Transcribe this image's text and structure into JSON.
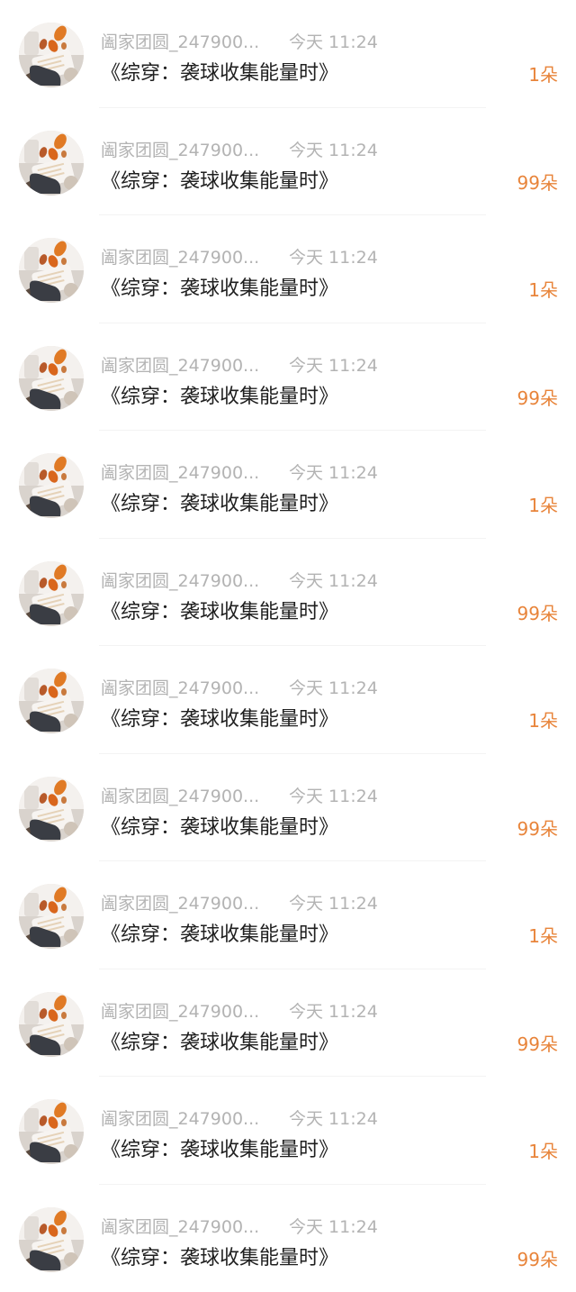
{
  "colors": {
    "meta_text": "#b3b3b3",
    "title_text": "#1f1f1f",
    "gift_accent": "#e8843a",
    "divider": "#f3f3f3"
  },
  "list": {
    "items": [
      {
        "avatar_icon": "user-avatar-autumn-leaves",
        "username": "阖家团圆_247900...",
        "time": "今天 11:24",
        "title": "《综穿：袭球收集能量时》",
        "gift": "1朵"
      },
      {
        "avatar_icon": "user-avatar-autumn-leaves",
        "username": "阖家团圆_247900...",
        "time": "今天 11:24",
        "title": "《综穿：袭球收集能量时》",
        "gift": "99朵"
      },
      {
        "avatar_icon": "user-avatar-autumn-leaves",
        "username": "阖家团圆_247900...",
        "time": "今天 11:24",
        "title": "《综穿：袭球收集能量时》",
        "gift": "1朵"
      },
      {
        "avatar_icon": "user-avatar-autumn-leaves",
        "username": "阖家团圆_247900...",
        "time": "今天 11:24",
        "title": "《综穿：袭球收集能量时》",
        "gift": "99朵"
      },
      {
        "avatar_icon": "user-avatar-autumn-leaves",
        "username": "阖家团圆_247900...",
        "time": "今天 11:24",
        "title": "《综穿：袭球收集能量时》",
        "gift": "1朵"
      },
      {
        "avatar_icon": "user-avatar-autumn-leaves",
        "username": "阖家团圆_247900...",
        "time": "今天 11:24",
        "title": "《综穿：袭球收集能量时》",
        "gift": "99朵"
      },
      {
        "avatar_icon": "user-avatar-autumn-leaves",
        "username": "阖家团圆_247900...",
        "time": "今天 11:24",
        "title": "《综穿：袭球收集能量时》",
        "gift": "1朵"
      },
      {
        "avatar_icon": "user-avatar-autumn-leaves",
        "username": "阖家团圆_247900...",
        "time": "今天 11:24",
        "title": "《综穿：袭球收集能量时》",
        "gift": "99朵"
      },
      {
        "avatar_icon": "user-avatar-autumn-leaves",
        "username": "阖家团圆_247900...",
        "time": "今天 11:24",
        "title": "《综穿：袭球收集能量时》",
        "gift": "1朵"
      },
      {
        "avatar_icon": "user-avatar-autumn-leaves",
        "username": "阖家团圆_247900...",
        "time": "今天 11:24",
        "title": "《综穿：袭球收集能量时》",
        "gift": "99朵"
      },
      {
        "avatar_icon": "user-avatar-autumn-leaves",
        "username": "阖家团圆_247900...",
        "time": "今天 11:24",
        "title": "《综穿：袭球收集能量时》",
        "gift": "1朵"
      },
      {
        "avatar_icon": "user-avatar-autumn-leaves",
        "username": "阖家团圆_247900...",
        "time": "今天 11:24",
        "title": "《综穿：袭球收集能量时》",
        "gift": "99朵"
      }
    ]
  }
}
